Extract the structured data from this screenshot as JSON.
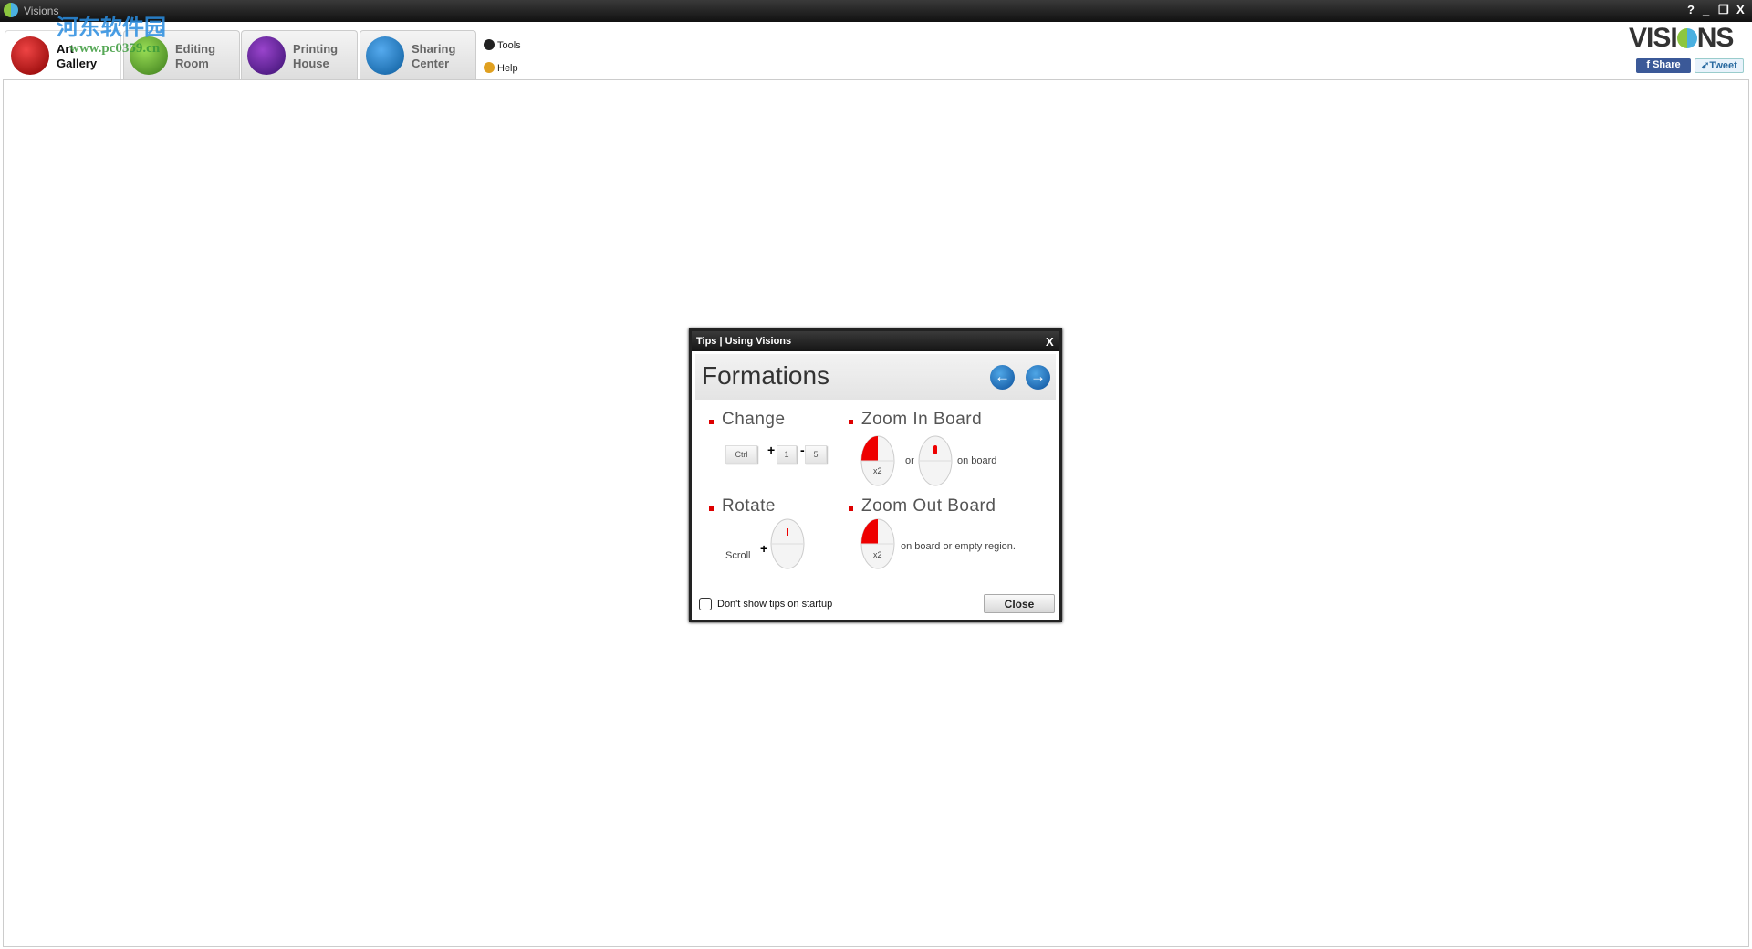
{
  "window": {
    "title": "Visions",
    "controls": [
      "?",
      "_",
      "❐",
      "X"
    ]
  },
  "tabs": [
    {
      "label_1": "Art",
      "label_2": "Gallery",
      "color": "#b01010",
      "active": true
    },
    {
      "label_1": "Editing",
      "label_2": "Room",
      "color": "#5aa82a",
      "active": false
    },
    {
      "label_1": "Printing",
      "label_2": "House",
      "color": "#5a2a90",
      "active": false
    },
    {
      "label_1": "Sharing",
      "label_2": "Center",
      "color": "#1a78c0",
      "active": false
    }
  ],
  "side_menu": {
    "tools": "Tools",
    "help": "Help"
  },
  "brand": {
    "logo_left": "VISI",
    "logo_right": "NS",
    "share": "Share",
    "tweet": "Tweet"
  },
  "watermark": {
    "cn": "河东软件园",
    "url": "www.pc0359.cn"
  },
  "dialog": {
    "title": "Tips | Using Visions",
    "close_x": "X",
    "heading": "Formations",
    "prev": "←",
    "next": "→",
    "change": {
      "label": "Change",
      "key_ctrl": "Ctrl",
      "plus": "+",
      "key_1": "1",
      "dash": "-",
      "key_5": "5"
    },
    "zoom_in": {
      "label": "Zoom In Board",
      "x2": "x2",
      "or": "or",
      "suffix": "on board"
    },
    "rotate": {
      "label": "Rotate",
      "scroll": "Scroll",
      "plus": "+"
    },
    "zoom_out": {
      "label": "Zoom Out Board",
      "x2": "x2",
      "suffix": "on board or empty region."
    },
    "checkbox_label": "Don't show tips on startup",
    "checkbox_checked": false,
    "close_button": "Close"
  }
}
